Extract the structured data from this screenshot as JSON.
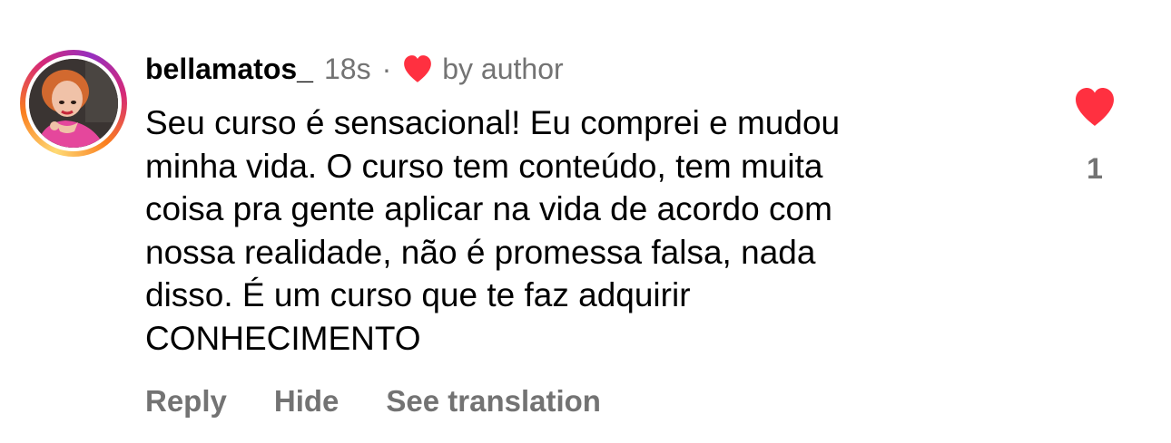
{
  "comment": {
    "username": "bellamatos_",
    "time": "18s",
    "separator": "·",
    "liked_by": "by author",
    "text": "Seu curso é sensacional! Eu comprei e mudou\nminha vida. O curso tem conteúdo, tem muita\ncoisa pra gente aplicar na vida de acordo com\nnossa realidade, não é promessa falsa, nada\ndisso. É um curso que te faz adquirir\nCONHECIMENTO",
    "like_count": "1"
  },
  "actions": {
    "reply": "Reply",
    "hide": "Hide",
    "see_translation": "See translation"
  },
  "icons": {
    "author_heart": "heart-filled-icon",
    "like_heart": "heart-filled-icon"
  },
  "colors": {
    "heart": "#ff3040",
    "secondary_text": "#737373"
  }
}
